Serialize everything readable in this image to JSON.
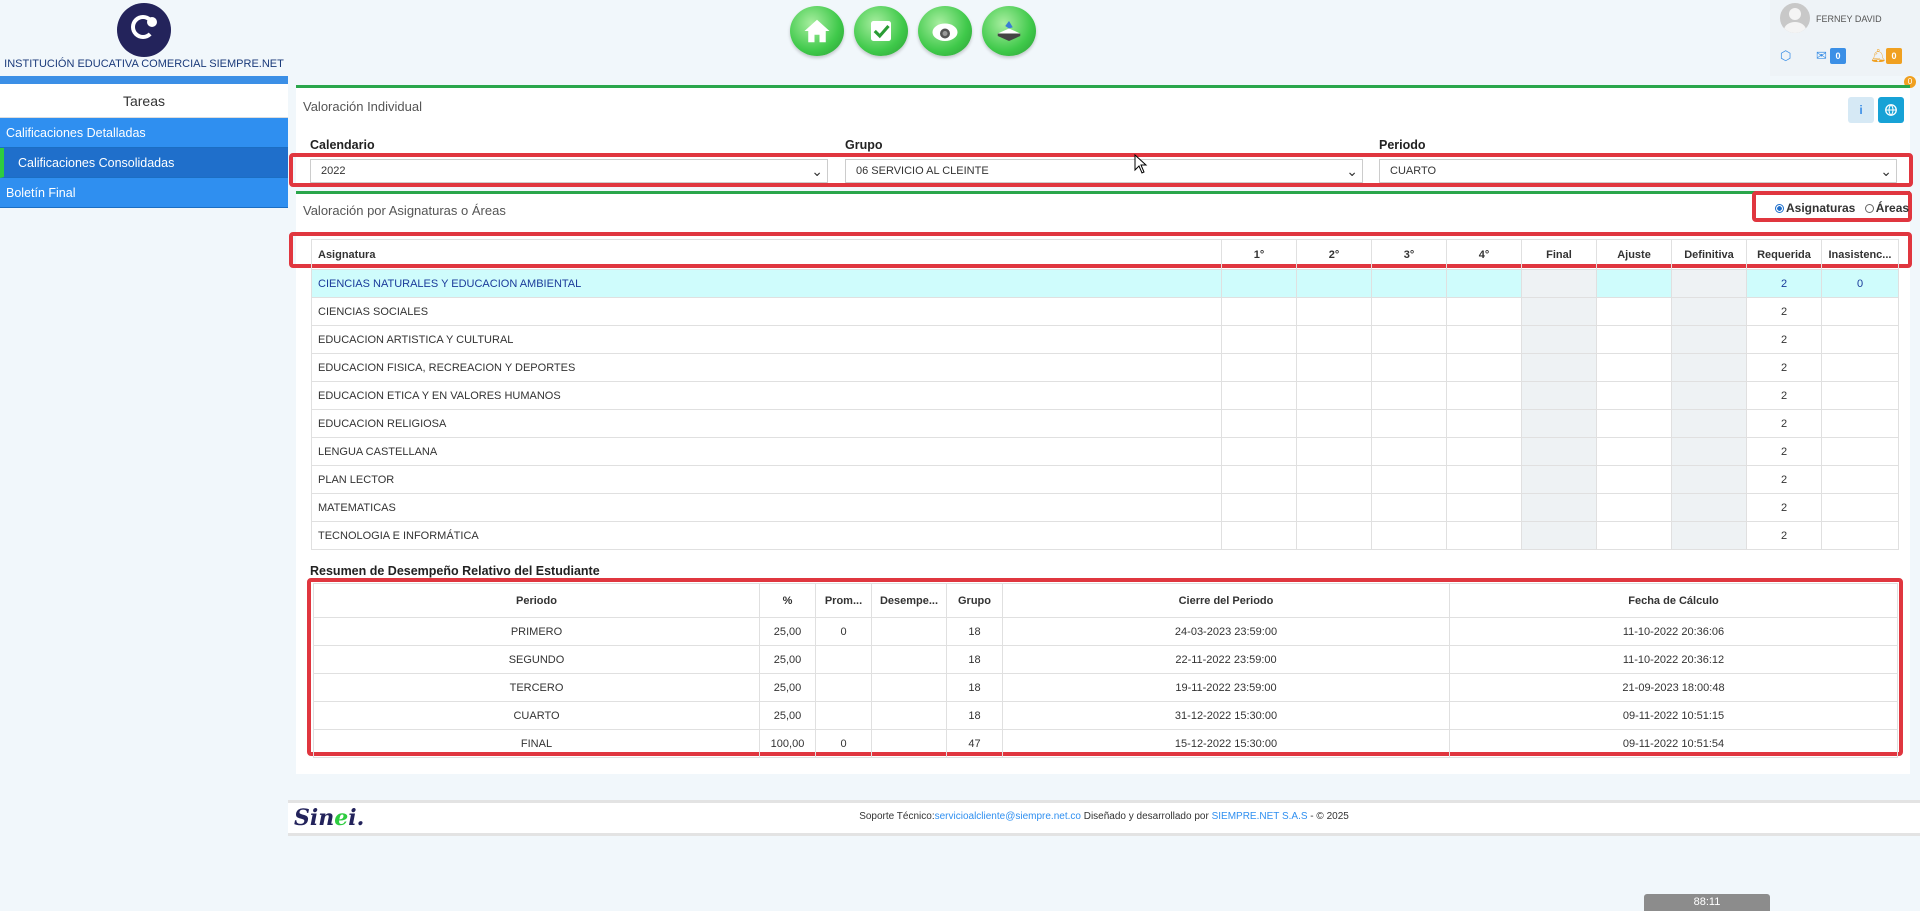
{
  "header": {
    "school_name": "INSTITUCIÓN EDUCATIVA COMERCIAL SIEMPRE.NET",
    "nav_icons": [
      "home-icon",
      "checkbox-icon",
      "camera-icon",
      "book-icon"
    ],
    "user_name": "FERNEY DAVID",
    "messages_count": "0",
    "notifications_count": "0",
    "corner_badge": "0"
  },
  "sidebar": {
    "title": "Tareas",
    "items": [
      {
        "label": "Calificaciones Detalladas"
      },
      {
        "label": "Calificaciones Consolidadas"
      },
      {
        "label": "Boletín Final"
      }
    ]
  },
  "main": {
    "section_title": "Valoración Individual",
    "info_btn": "i",
    "filters": {
      "calendar_label": "Calendario",
      "calendar_value": "2022",
      "group_label": "Grupo",
      "group_value": "06 SERVICIO AL CLEINTE",
      "period_label": "Periodo",
      "period_value": "CUARTO"
    },
    "valuation_title": "Valoración por Asignaturas o Áreas",
    "radio_subjects": "Asignaturas",
    "radio_areas": "Áreas",
    "grades_table": {
      "headers": [
        "Asignatura",
        "1°",
        "2°",
        "3°",
        "4°",
        "Final",
        "Ajuste",
        "Definitiva",
        "Requerida",
        "Inasistenc..."
      ],
      "rows": [
        {
          "subject": "CIENCIAS NATURALES Y EDUCACION AMBIENTAL",
          "required": "2",
          "absences": "0"
        },
        {
          "subject": "CIENCIAS SOCIALES",
          "required": "2",
          "absences": ""
        },
        {
          "subject": "EDUCACION ARTISTICA Y CULTURAL",
          "required": "2",
          "absences": ""
        },
        {
          "subject": "EDUCACION FISICA, RECREACION Y DEPORTES",
          "required": "2",
          "absences": ""
        },
        {
          "subject": "EDUCACION ETICA Y EN VALORES HUMANOS",
          "required": "2",
          "absences": ""
        },
        {
          "subject": "EDUCACION RELIGIOSA",
          "required": "2",
          "absences": ""
        },
        {
          "subject": "LENGUA CASTELLANA",
          "required": "2",
          "absences": ""
        },
        {
          "subject": "PLAN LECTOR",
          "required": "2",
          "absences": ""
        },
        {
          "subject": "MATEMATICAS",
          "required": "2",
          "absences": ""
        },
        {
          "subject": "TECNOLOGIA E INFORMÁTICA",
          "required": "2",
          "absences": ""
        }
      ]
    },
    "summary_title": "Resumen de Desempeño Relativo del Estudiante",
    "summary_table": {
      "headers": [
        "Periodo",
        "%",
        "Prom...",
        "Desempe...",
        "Grupo",
        "Cierre del Periodo",
        "Fecha de Cálculo"
      ],
      "rows": [
        [
          "PRIMERO",
          "25,00",
          "0",
          "",
          "18",
          "24-03-2023 23:59:00",
          "11-10-2022 20:36:06"
        ],
        [
          "SEGUNDO",
          "25,00",
          "",
          "",
          "18",
          "22-11-2022 23:59:00",
          "11-10-2022 20:36:12"
        ],
        [
          "TERCERO",
          "25,00",
          "",
          "",
          "18",
          "19-11-2022 23:59:00",
          "21-09-2023 18:00:48"
        ],
        [
          "CUARTO",
          "25,00",
          "",
          "",
          "18",
          "31-12-2022 15:30:00",
          "09-11-2022 10:51:15"
        ],
        [
          "FINAL",
          "100,00",
          "0",
          "",
          "47",
          "15-12-2022 15:30:00",
          "09-11-2022 10:51:54"
        ]
      ]
    }
  },
  "footer": {
    "logo_prefix": "Sin",
    "logo_mid": "e",
    "logo_suffix": "i.",
    "support_label": "Soporte Técnico:",
    "support_email": "servicioalcliente@siempre.net.co",
    "designed_by": " Diseñado y desarrollado por ",
    "company": "SIEMPRE.NET S.A.S",
    "copyright": " -  © 2025"
  },
  "timer": "88:11",
  "colors": {
    "accent_green": "#2aa64b",
    "sidebar_blue": "#2f8ff0",
    "highlight": "#e0363f"
  }
}
